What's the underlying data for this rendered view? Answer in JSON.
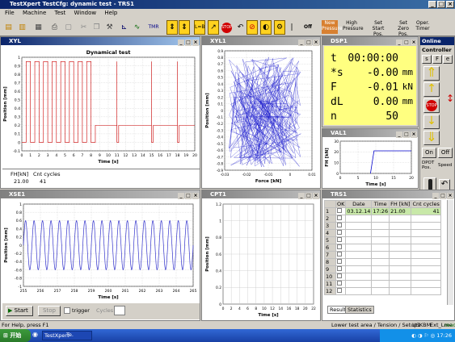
{
  "app": {
    "title": "TestXpert   TestCfg: dynamic test - TRS1"
  },
  "menu": [
    "File",
    "Machine",
    "Test",
    "Window",
    "Help"
  ],
  "toolbar": {
    "items": [
      {
        "icon": "new-icon"
      },
      {
        "icon": "open-icon"
      },
      {
        "icon": "save-icon"
      },
      {
        "icon": "print-icon"
      },
      {
        "icon": "preview-icon"
      },
      {
        "icon": "cut-icon"
      },
      {
        "icon": "copy-icon"
      },
      {
        "icon": "hammer-icon"
      },
      {
        "icon": "chart-icon"
      },
      {
        "icon": "graph-icon"
      },
      {
        "icon": "tmr-icon"
      }
    ],
    "tmr_label": "TMR",
    "off_label": "Off",
    "new_pressure": "New Pressure",
    "high_pressure": "High Pressure",
    "set_start": "Set Start Pos.",
    "set_zero": "Set Zero Pos.",
    "oper_timer": "Oper. Timer"
  },
  "win_xy": {
    "title": "XYL",
    "chart_data": {
      "type": "line",
      "title": "Dynamical test",
      "xlabel": "Time [s]",
      "ylabel": "Position [mm]",
      "xlim": [
        0,
        20
      ],
      "ylim": [
        -0.1,
        1.0
      ],
      "xticks": [
        "0",
        "1",
        "2",
        "3",
        "4",
        "5",
        "6",
        "7",
        "8",
        "9",
        "10",
        "11",
        "12",
        "13",
        "14",
        "15",
        "16",
        "17",
        "18",
        "19",
        "20"
      ],
      "yticks": [
        "1",
        "0.9",
        "0.8",
        "0.7",
        "0.6",
        "0.5",
        "0.4",
        "0.3",
        "0.2",
        "0.1",
        "0",
        "-0.1"
      ],
      "series": [
        {
          "color": "#cc0000",
          "segments": [
            {
              "kind": "square",
              "from": 0.5,
              "to": 8.5,
              "period": 1.0,
              "lo": 0.0,
              "hi": 0.95
            },
            {
              "kind": "steps",
              "points": [
                [
                  8.5,
                  0.0
                ],
                [
                  8.5,
                  0.2
                ],
                [
                  11,
                  0.2
                ],
                [
                  11,
                  0.95
                ],
                [
                  11,
                  0.0
                ],
                [
                  11.2,
                  0.0
                ],
                [
                  11.2,
                  0.2
                ],
                [
                  15,
                  0.2
                ],
                [
                  15,
                  0.95
                ],
                [
                  15,
                  0.0
                ],
                [
                  15.2,
                  0.0
                ],
                [
                  15.2,
                  0.2
                ],
                [
                  18,
                  0.2
                ],
                [
                  18,
                  0.95
                ],
                [
                  18,
                  0.0
                ],
                [
                  18.2,
                  0.0
                ],
                [
                  18.2,
                  0.2
                ],
                [
                  20,
                  0.2
                ]
              ]
            }
          ]
        }
      ]
    },
    "table": {
      "headers": [
        "FH[kN]",
        "Cnt cycles"
      ],
      "row": [
        "21.00",
        "41"
      ]
    }
  },
  "win_xy1": {
    "title": "XYL1",
    "chart_data": {
      "type": "line",
      "xlabel": "Force [kN]",
      "ylabel": "Position [mm]",
      "xlim": [
        -0.03,
        0.01
      ],
      "ylim": [
        -0.9,
        0.9
      ],
      "xticks": [
        "-0.03",
        "-0.02",
        "-0.01",
        "0",
        "0.01"
      ],
      "yticks": [
        "0.9",
        "0.8",
        "0.7",
        "0.6",
        "0.5",
        "0.4",
        "0.3",
        "0.2",
        "0.1",
        "0",
        "-0.1",
        "-0.2",
        "-0.3",
        "-0.4",
        "-0.5",
        "-0.6",
        "-0.7",
        "-0.8",
        "-0.9"
      ],
      "series": [
        {
          "color": "#0000cc",
          "style": "noise"
        }
      ]
    }
  },
  "win_dsp": {
    "title": "DSP1",
    "rows": [
      {
        "label": "t",
        "value": "00:00:00",
        "unit": ""
      },
      {
        "label": "*s",
        "value": "-0.00",
        "unit": "mm"
      },
      {
        "label": "F",
        "value": "-0.01",
        "unit": "kN"
      },
      {
        "label": "dL",
        "value": "0.00",
        "unit": "mm"
      },
      {
        "label": "n",
        "value": "50",
        "unit": ""
      }
    ]
  },
  "controller": {
    "title": "Online",
    "label": "Controller",
    "btn_s": "s",
    "btn_f": "F",
    "btn_e": "e",
    "on": "On",
    "off": "Off",
    "dpot": "DPOT Pos.",
    "speed": "Speed"
  },
  "win_val": {
    "title": "VAL1",
    "chart_data": {
      "type": "line",
      "xlabel": "Time [s]",
      "ylabel": "FH [kN]",
      "xlim": [
        0,
        20
      ],
      "ylim": [
        0,
        30
      ],
      "xticks": [
        "0",
        "5",
        "10",
        "15",
        "20"
      ],
      "yticks": [
        "30",
        "20",
        "10",
        "0"
      ],
      "series": [
        {
          "color": "#0000cc",
          "points": [
            [
              8.5,
              0
            ],
            [
              9.5,
              21
            ],
            [
              20,
              21
            ]
          ]
        }
      ]
    }
  },
  "win_sig": {
    "title": "XSE1",
    "chart_data": {
      "type": "line",
      "xlabel": "Time [s]",
      "ylabel": "Position [mm]",
      "xlim": [
        255,
        265
      ],
      "ylim": [
        -1.0,
        1.0
      ],
      "xticks": [
        "255",
        "256",
        "257",
        "258",
        "259",
        "260",
        "261",
        "262",
        "263",
        "264",
        "265"
      ],
      "yticks": [
        "1",
        "0.8",
        "0.6",
        "0.4",
        "0.2",
        "0",
        "-0.2",
        "-0.4",
        "-0.6",
        "-0.8",
        "-1"
      ],
      "series": [
        {
          "color": "#3333cc",
          "style": "sine",
          "amplitude": 0.6,
          "cycles": 20
        }
      ]
    },
    "bottom": {
      "start": "Start",
      "stop": "Stop",
      "trigger": "trigger",
      "cycles": "Cycles"
    }
  },
  "win_empty": {
    "title": "CPT1",
    "chart_data": {
      "type": "line",
      "xlabel": "Time [s]",
      "ylabel": "Position [mm]",
      "xlim": [
        0,
        22
      ],
      "ylim": [
        0,
        1.2
      ],
      "xticks": [
        "0",
        "2",
        "4",
        "6",
        "8",
        "10",
        "12",
        "14",
        "16",
        "18",
        "20",
        "22"
      ],
      "yticks": [
        "1.2",
        "1",
        "0.8",
        "0.6",
        "0.4",
        "0.2",
        "0"
      ],
      "series": []
    }
  },
  "win_res": {
    "title": "TRS1",
    "headers": [
      "",
      "OK",
      "Date",
      "Time",
      "FH [kN]",
      "Cnt cycles"
    ],
    "rows": [
      [
        "1",
        "",
        "03.12.14",
        "17:26",
        "21.00",
        "41"
      ],
      [
        "2",
        "",
        "",
        "",
        "",
        ""
      ],
      [
        "3",
        "",
        "",
        "",
        "",
        ""
      ],
      [
        "4",
        "",
        "",
        "",
        "",
        ""
      ],
      [
        "5",
        "",
        "",
        "",
        "",
        ""
      ],
      [
        "6",
        "",
        "",
        "",
        "",
        ""
      ],
      [
        "7",
        "",
        "",
        "",
        "",
        ""
      ],
      [
        "8",
        "",
        "",
        "",
        "",
        ""
      ],
      [
        "9",
        "",
        "",
        "",
        "",
        ""
      ],
      [
        "10",
        "",
        "",
        "",
        "",
        ""
      ],
      [
        "11",
        "",
        "",
        "",
        "",
        ""
      ],
      [
        "12",
        "",
        "",
        "",
        "",
        ""
      ]
    ],
    "tabs": [
      "Results",
      "Statistics"
    ]
  },
  "status": {
    "help": "For Help, press F1",
    "area": "Lower test area / Tension / Setup1",
    "mode": "USKBM",
    "lang": "Ext_Lme",
    "ready": "ready"
  },
  "taskbar": {
    "start": "开始",
    "task1": "TestXpert",
    "task2": "Te.",
    "clock": "17:26"
  }
}
